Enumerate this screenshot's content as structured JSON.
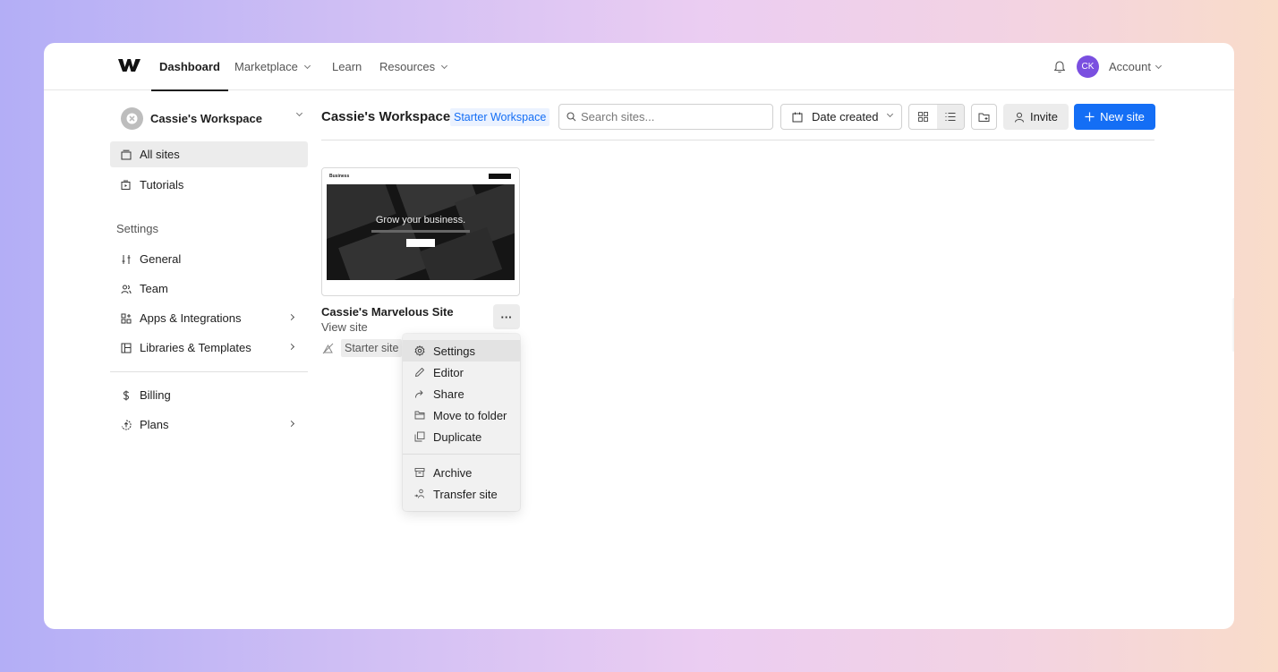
{
  "nav": {
    "items": [
      {
        "label": "Dashboard",
        "active": true,
        "dropdown": false
      },
      {
        "label": "Marketplace",
        "active": false,
        "dropdown": true
      },
      {
        "label": "Learn",
        "active": false,
        "dropdown": false
      },
      {
        "label": "Resources",
        "active": false,
        "dropdown": true
      }
    ],
    "avatar_initials": "CK",
    "account_label": "Account"
  },
  "sidebar": {
    "workspace_name": "Cassie's Workspace",
    "items": [
      {
        "label": "All sites",
        "icon": "sites-icon",
        "active": true
      },
      {
        "label": "Tutorials",
        "icon": "tutorials-icon",
        "active": false
      }
    ],
    "settings_heading": "Settings",
    "settings_items": [
      {
        "label": "General",
        "icon": "sliders-icon",
        "arrow": false
      },
      {
        "label": "Team",
        "icon": "team-icon",
        "arrow": false
      },
      {
        "label": "Apps & Integrations",
        "icon": "apps-icon",
        "arrow": true
      },
      {
        "label": "Libraries & Templates",
        "icon": "libraries-icon",
        "arrow": true
      }
    ],
    "billing_items": [
      {
        "label": "Billing",
        "icon": "dollar-icon",
        "arrow": false
      },
      {
        "label": "Plans",
        "icon": "plans-icon",
        "arrow": true
      }
    ]
  },
  "main": {
    "title": "Cassie's Workspace",
    "workspace_badge": "Starter Workspace",
    "search_placeholder": "Search sites...",
    "sort_label": "Date created",
    "invite_label": "Invite",
    "new_site_label": "New site",
    "more_label": "···"
  },
  "site": {
    "name": "Cassie's Marvelous Site",
    "link_label": "View site",
    "plan_label": "Starter site",
    "thumbnail": {
      "brand": "Business",
      "heading": "Grow your business."
    }
  },
  "menu": {
    "items": [
      {
        "label": "Settings",
        "icon": "gear-icon"
      },
      {
        "label": "Editor",
        "icon": "pencil-icon"
      },
      {
        "label": "Share",
        "icon": "share-icon"
      },
      {
        "label": "Move to folder",
        "icon": "folder-icon"
      },
      {
        "label": "Duplicate",
        "icon": "duplicate-icon"
      },
      {
        "label": "Archive",
        "icon": "archive-icon"
      },
      {
        "label": "Transfer site",
        "icon": "transfer-icon"
      }
    ]
  },
  "colors": {
    "accent": "#146ef5",
    "avatar": "#7a4fe0",
    "badge_bg": "#ebf2ff"
  }
}
